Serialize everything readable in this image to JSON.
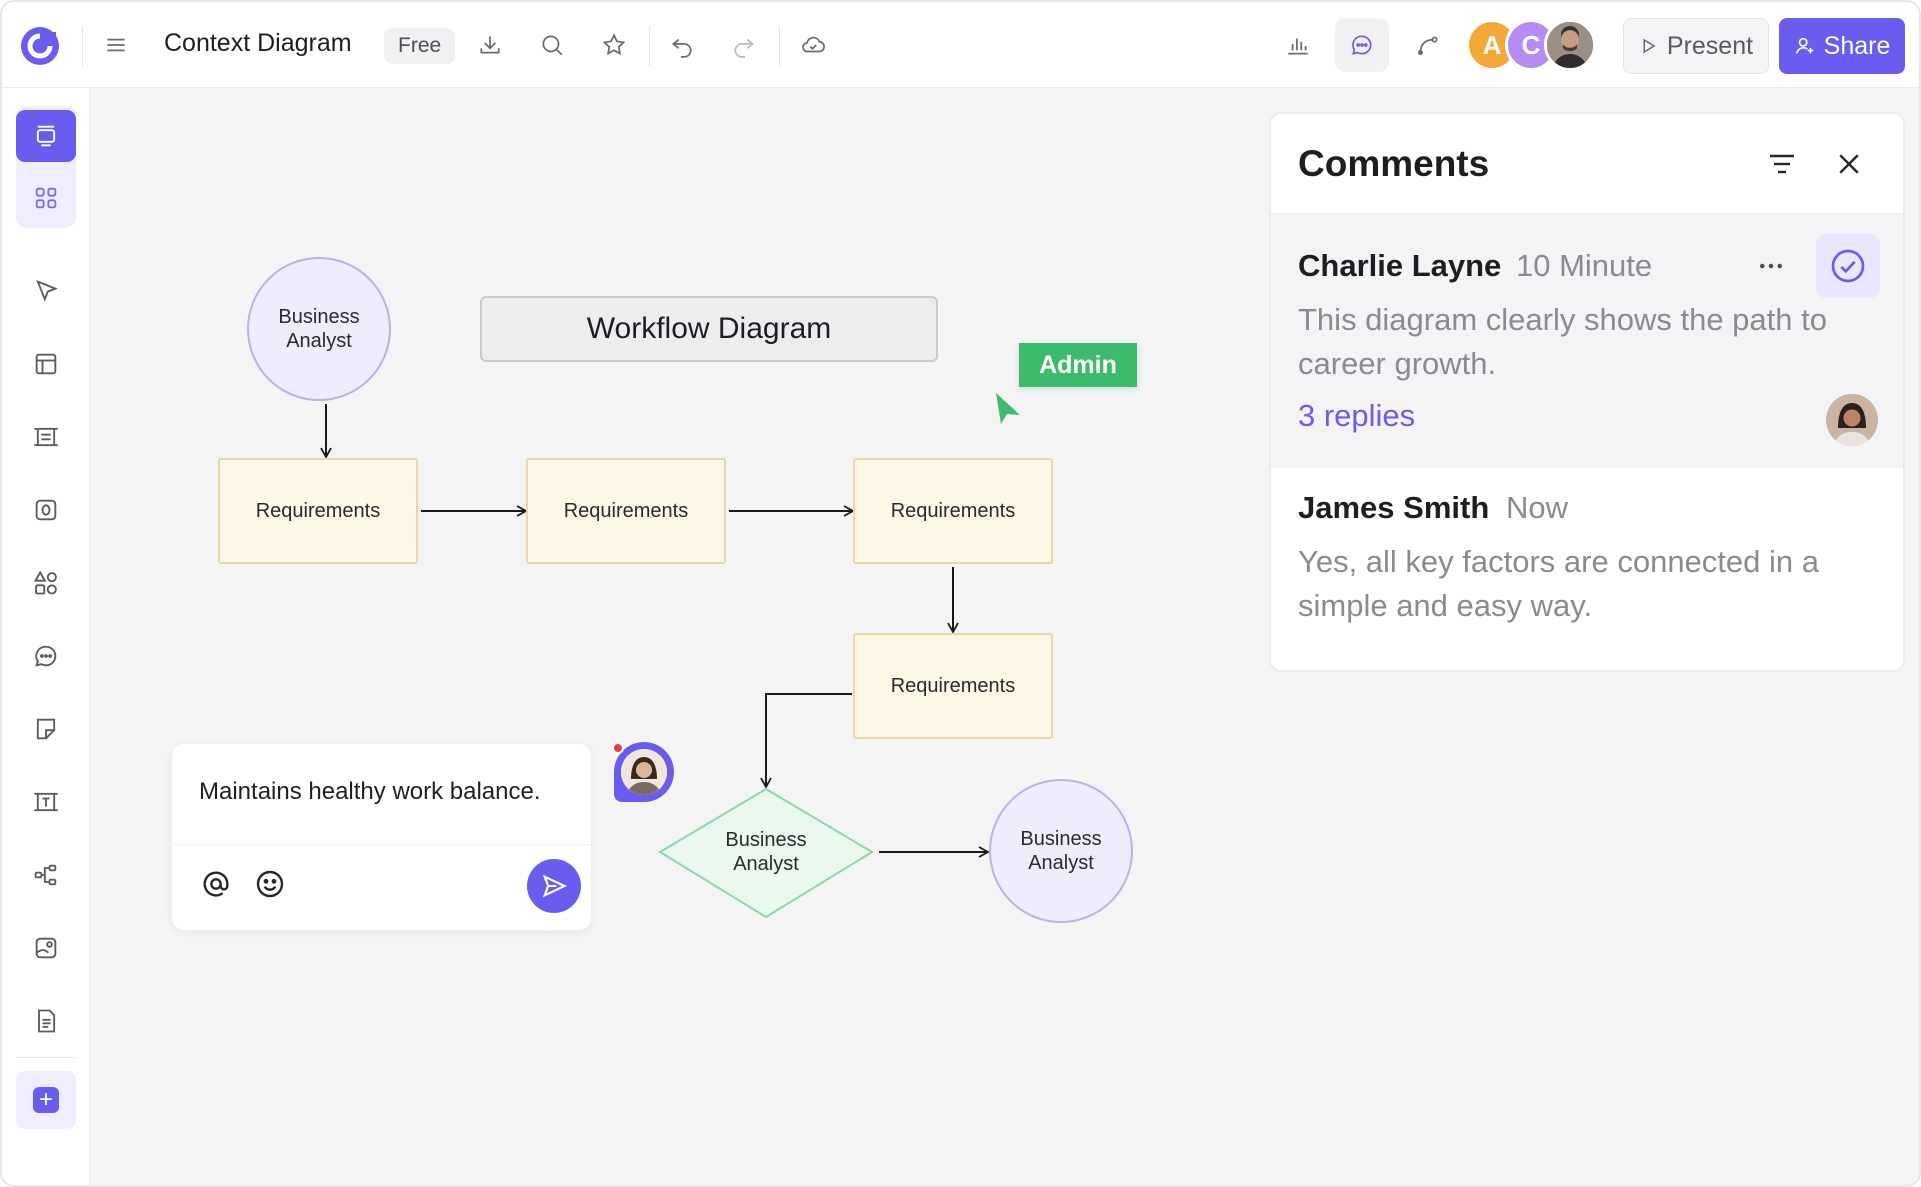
{
  "topbar": {
    "title": "Context Diagram",
    "plan_badge": "Free",
    "avatars": [
      {
        "initial": "A",
        "color": "#f5a83a"
      },
      {
        "initial": "C",
        "color": "#b68cf2"
      }
    ],
    "present_label": "Present",
    "share_label": "Share"
  },
  "sidebar": {
    "tools": [
      "frames-icon",
      "grid-icon",
      "pointer-icon",
      "layout-icon",
      "frame-list-icon",
      "shape-o-icon",
      "shapes-icon",
      "comment-icon",
      "sticky-note-icon",
      "text-frame-icon",
      "mindmap-icon",
      "image-icon",
      "document-icon",
      "add-icon"
    ]
  },
  "diagram": {
    "title": "Workflow Diagram",
    "admin_label": "Admin",
    "circle_top": "Business Analyst",
    "circle_bottom": "Business Analyst",
    "diamond": "Business Analyst",
    "requirements": [
      "Requirements",
      "Requirements",
      "Requirements",
      "Requirements"
    ]
  },
  "comment_input": {
    "text": "Maintains healthy work balance."
  },
  "comments_panel": {
    "title": "Comments",
    "threads": [
      {
        "author": "Charlie Layne",
        "time": "10 Minute",
        "text": "This diagram clearly shows the path to career growth.",
        "replies": "3 replies"
      },
      {
        "author": "James Smith",
        "time": "Now",
        "text": "Yes, all key factors are connected in a simple and easy way."
      }
    ]
  },
  "colors": {
    "accent": "#6b5cf0",
    "admin_green": "#3dbb6c",
    "node_fill": "#fdf8e6",
    "circle_fill": "#efedfd"
  }
}
